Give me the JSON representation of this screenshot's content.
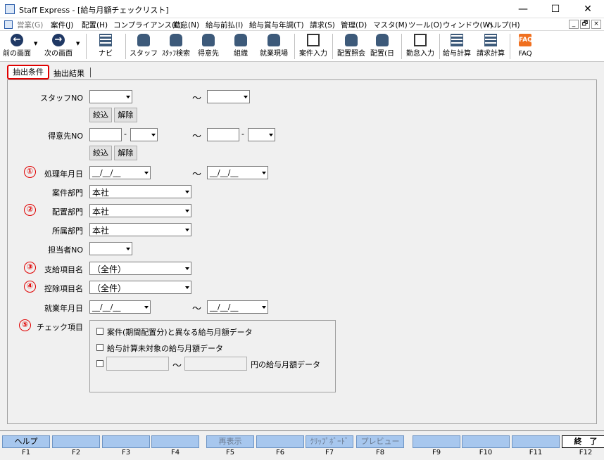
{
  "window": {
    "title": "Staff Express - [給与月額チェックリスト]",
    "minimize": "—",
    "maximize": "☐",
    "close": "✕"
  },
  "menu": [
    {
      "label": "営業(G)",
      "disabled": true
    },
    {
      "label": "案件(J)"
    },
    {
      "label": "配置(H)"
    },
    {
      "label": "コンプライアンス(C)"
    },
    {
      "label": "勤怠(N)"
    },
    {
      "label": "給与前払(I)"
    },
    {
      "label": "給与賞与年調(T)"
    },
    {
      "label": "請求(S)"
    },
    {
      "label": "管理(D)"
    },
    {
      "label": "マスタ(M)"
    },
    {
      "label": "ツール(O)"
    },
    {
      "label": "ウィンドウ(W)"
    },
    {
      "label": "ヘルプ(H)"
    }
  ],
  "mdi": {
    "minimize": "_",
    "restore": "🗗",
    "close": "×"
  },
  "toolbar": {
    "back": "前の画面",
    "next": "次の画面",
    "navi": "ナビ",
    "staff": "スタッフ",
    "staff_search": "ｽﾀｯﾌ検索",
    "client": "得意先",
    "org": "組織",
    "site": "就業現場",
    "case_input": "案件入力",
    "assign_view": "配置照会",
    "assign_day": "配置(日",
    "attendance": "勤怠入力",
    "pay_calc": "給与計算",
    "bill_calc": "請求計算",
    "faq": "FAQ",
    "faq_icon": "FAQ"
  },
  "tabs": {
    "active": "抽出条件",
    "other": "抽出結果"
  },
  "form": {
    "staff_no_label": "スタッフNO",
    "tilde": "～",
    "filter_btn": "絞込",
    "clear_btn": "解除",
    "client_no_label": "得意先NO",
    "dash": "-",
    "proc_date_label": "処理年月日",
    "date_placeholder": "__/__/__",
    "case_dept_label": "案件部門",
    "case_dept_value": "本社",
    "assign_dept_label": "配置部門",
    "assign_dept_value": "本社",
    "belong_dept_label": "所属部門",
    "belong_dept_value": "本社",
    "staff_in_charge_label": "担当者NO",
    "pay_item_label": "支給項目名",
    "pay_item_value": "（全件）",
    "deduct_item_label": "控除項目名",
    "deduct_item_value": "（全件）",
    "work_date_label": "就業年月日",
    "check_label": "チェック項目",
    "check1": "案件(期間配置分)と異なる給与月額データ",
    "check2": "給与計算未対象の給与月額データ",
    "check3_suffix": "円の給与月額データ",
    "markers": [
      "①",
      "②",
      "③",
      "④",
      "⑤"
    ]
  },
  "fkeys": [
    {
      "label": "ヘルプ",
      "key": "F1"
    },
    {
      "label": "",
      "key": "F2"
    },
    {
      "label": "",
      "key": "F3"
    },
    {
      "label": "",
      "key": "F4"
    },
    {
      "label": "再表示",
      "key": "F5",
      "disabled": true
    },
    {
      "label": "",
      "key": "F6"
    },
    {
      "label": "ｸﾘｯﾌﾟﾎﾞｰﾄﾞ",
      "key": "F7",
      "disabled": true
    },
    {
      "label": "プレビュー",
      "key": "F8",
      "disabled": true
    },
    {
      "label": "",
      "key": "F9"
    },
    {
      "label": "",
      "key": "F10"
    },
    {
      "label": "",
      "key": "F11"
    },
    {
      "label": "終　了",
      "key": "F12"
    }
  ]
}
